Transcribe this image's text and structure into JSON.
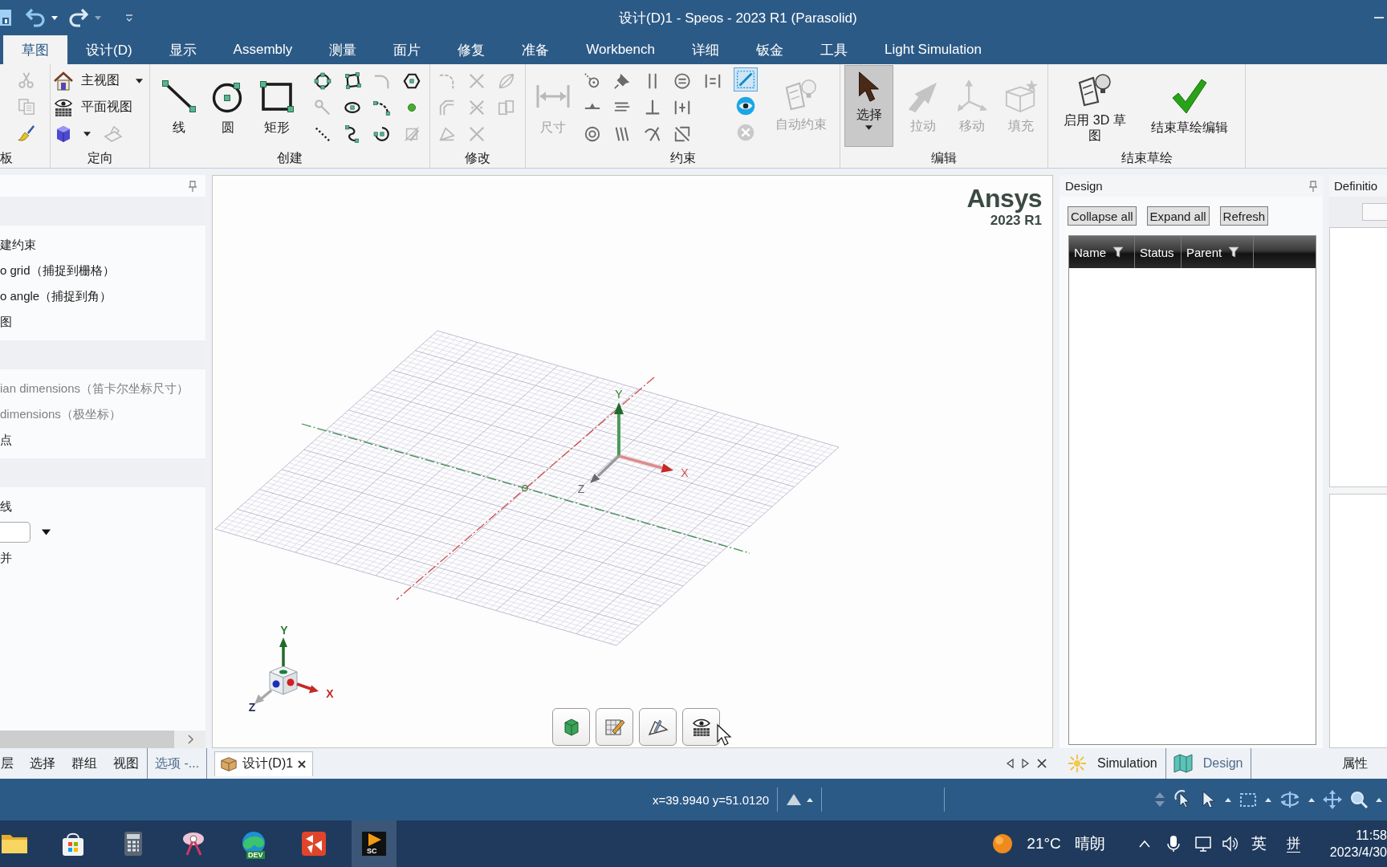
{
  "window": {
    "title": "设计(D)1 - Speos - 2023 R1 (Parasolid)"
  },
  "ribbon_tabs": [
    {
      "label": "草图",
      "selected": true
    },
    {
      "label": "设计(D)",
      "selected": false
    },
    {
      "label": "显示",
      "selected": false
    },
    {
      "label": "Assembly",
      "selected": false
    },
    {
      "label": "测量",
      "selected": false
    },
    {
      "label": "面片",
      "selected": false
    },
    {
      "label": "修复",
      "selected": false
    },
    {
      "label": "准备",
      "selected": false
    },
    {
      "label": "Workbench",
      "selected": false
    },
    {
      "label": "详细",
      "selected": false
    },
    {
      "label": "钣金",
      "selected": false
    },
    {
      "label": "工具",
      "selected": false
    },
    {
      "label": "Light Simulation",
      "selected": false
    }
  ],
  "ribbon": {
    "clipboard": {
      "label": "板",
      "tools": [
        {
          "disabled": true
        },
        {
          "disabled": true
        },
        {
          "disabled": false
        }
      ]
    },
    "orient": {
      "label": "定向",
      "views": [
        {
          "label": "主视图",
          "dropdown": true
        },
        {
          "label": "平面视图",
          "dropdown": false
        }
      ],
      "tools": [
        {
          "disabled": false,
          "dropdown": true
        },
        {
          "disabled": true,
          "dropdown": false
        }
      ]
    },
    "create": {
      "label": "创建",
      "large": [
        {
          "label": "线"
        },
        {
          "label": "圆"
        },
        {
          "label": "矩形"
        }
      ],
      "tools": [
        {
          "disabled": false
        },
        {
          "disabled": false
        },
        {
          "disabled": true
        },
        {
          "disabled": false
        },
        {
          "disabled": true
        },
        {
          "disabled": false
        },
        {
          "disabled": false
        },
        {
          "disabled": false
        },
        {
          "disabled": false
        },
        {
          "disabled": false
        },
        {
          "disabled": false
        },
        {
          "disabled": true
        }
      ]
    },
    "modify": {
      "label": "修改",
      "tools": [
        {
          "disabled": true
        },
        {
          "disabled": true
        },
        {
          "disabled": true
        },
        {
          "disabled": true
        },
        {
          "disabled": true
        },
        {
          "disabled": true
        },
        {
          "disabled": true
        },
        {
          "disabled": true
        }
      ]
    },
    "constrain": {
      "label": "约束",
      "dimension": {
        "label": "尺寸",
        "disabled": true
      },
      "tools": [
        {
          "disabled": false
        },
        {
          "disabled": false
        },
        {
          "disabled": false
        },
        {
          "disabled": false
        },
        {
          "disabled": false
        },
        {
          "disabled": false
        },
        {
          "disabled": false
        },
        {
          "disabled": false
        },
        {
          "disabled": false
        },
        {
          "disabled": false
        },
        {
          "disabled": false
        },
        {
          "disabled": false
        },
        {
          "disabled": false
        }
      ],
      "toggles": [
        {
          "selected": true,
          "disabled": false
        },
        {
          "selected": false,
          "disabled": false
        },
        {
          "selected": false,
          "disabled": true
        }
      ],
      "auto": {
        "label": "自动约束",
        "disabled": true
      }
    },
    "edit": {
      "label": "编辑",
      "tools": [
        {
          "label": "选择",
          "selected": true,
          "disabled": false,
          "dropdown": true
        },
        {
          "label": "拉动",
          "selected": false,
          "disabled": true,
          "dropdown": false
        },
        {
          "label": "移动",
          "selected": false,
          "disabled": true,
          "dropdown": false
        },
        {
          "label": "填充",
          "selected": false,
          "disabled": true,
          "dropdown": false
        }
      ]
    },
    "finish": {
      "label": "结束草绘",
      "tools": [
        {
          "label": "启用 3D 草图"
        },
        {
          "label": "结束草绘编辑"
        }
      ]
    }
  },
  "options_panel": {
    "sections": [
      {
        "items": [
          {
            "kind": "text",
            "label": "建约束",
            "disabled": false
          },
          {
            "kind": "text",
            "label": "o grid（捕捉到栅格）",
            "disabled": false
          },
          {
            "kind": "text",
            "label": "o angle（捕捉到角）",
            "disabled": false
          },
          {
            "kind": "text",
            "label": "图",
            "disabled": false
          }
        ]
      },
      {
        "items": [
          {
            "kind": "text",
            "label": "ian dimensions（笛卡尔坐标尺寸）",
            "disabled": true
          },
          {
            "kind": "text",
            "label": "dimensions（极坐标）",
            "disabled": true
          },
          {
            "kind": "text",
            "label": "点",
            "disabled": false
          }
        ]
      },
      {
        "items": [
          {
            "kind": "text",
            "label": "线",
            "disabled": false
          },
          {
            "kind": "field",
            "disabled": false
          },
          {
            "kind": "text",
            "label": "并",
            "disabled": false
          }
        ]
      }
    ],
    "tabs": [
      {
        "label": "层",
        "selected": false
      },
      {
        "label": "选择",
        "selected": false
      },
      {
        "label": "群组",
        "selected": false
      },
      {
        "label": "视图",
        "selected": false
      },
      {
        "label": "选项 -...",
        "selected": true
      }
    ]
  },
  "viewport": {
    "logo": {
      "brand": "Ansys",
      "version": "2023 R1"
    },
    "triad_labels": [
      "Y",
      "X",
      "Z"
    ],
    "cube_labels": [
      "Y",
      "X",
      "Z"
    ]
  },
  "document_tabs": [
    {
      "label": "设计(D)1",
      "selected": true
    }
  ],
  "design_panel": {
    "title": "Design",
    "buttons": [
      "Collapse all",
      "Expand all",
      "Refresh"
    ],
    "columns": [
      {
        "label": "Name",
        "filter": true
      },
      {
        "label": "Status",
        "filter": false
      },
      {
        "label": "Parent",
        "filter": true
      }
    ],
    "tabs": [
      {
        "label": "Simulation",
        "selected": false
      },
      {
        "label": "Design",
        "selected": true
      }
    ]
  },
  "definition_panel": {
    "title": "Definitio",
    "tabs": [
      "属性"
    ]
  },
  "status_bar": {
    "coordinates": "x=39.9940 y=51.0120"
  },
  "taskbar": {
    "apps": [
      {
        "selected": false
      },
      {
        "selected": false
      },
      {
        "selected": false
      },
      {
        "selected": false
      },
      {
        "selected": false,
        "badge": "DEV"
      },
      {
        "selected": false
      },
      {
        "selected": true,
        "badge": "SC"
      }
    ],
    "weather": {
      "temperature": "21°C",
      "condition": "晴朗"
    },
    "input_mode": "英",
    "ime_icon": "拼",
    "time": "11:58",
    "date": "2023/4/30"
  }
}
